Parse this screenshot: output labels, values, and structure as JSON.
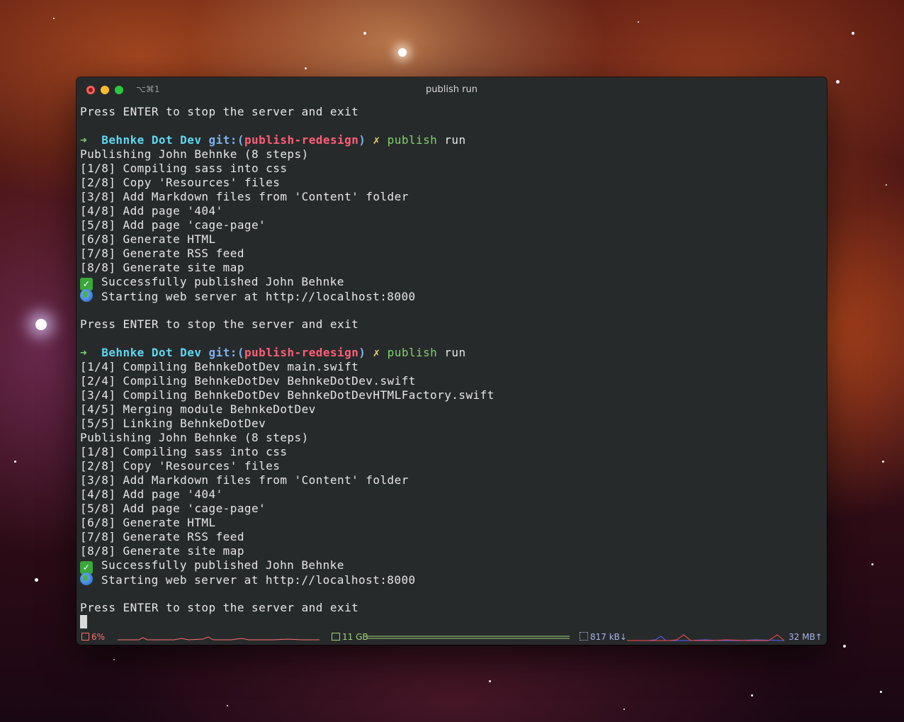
{
  "window": {
    "title": "publish run",
    "tab_shortcut": "⌥⌘1"
  },
  "terminal": {
    "lines": [
      {
        "t": "plain",
        "text": "Press ENTER to stop the server and exit"
      },
      {
        "t": "blank"
      },
      {
        "t": "prompt",
        "arrow": "➜",
        "dir": "Behnke Dot Dev",
        "git": "git:(",
        "branch": "publish-redesign",
        "git_close": ")",
        "dirty": "✗",
        "cmd": "publish",
        "args": " run"
      },
      {
        "t": "plain",
        "text": "Publishing John Behnke (8 steps)"
      },
      {
        "t": "plain",
        "text": "[1/8] Compiling sass into css"
      },
      {
        "t": "plain",
        "text": "[2/8] Copy 'Resources' files"
      },
      {
        "t": "plain",
        "text": "[3/8] Add Markdown files from 'Content' folder"
      },
      {
        "t": "plain",
        "text": "[4/8] Add page '404'"
      },
      {
        "t": "plain",
        "text": "[5/8] Add page 'cage-page'"
      },
      {
        "t": "plain",
        "text": "[6/8] Generate HTML"
      },
      {
        "t": "plain",
        "text": "[7/8] Generate RSS feed"
      },
      {
        "t": "plain",
        "text": "[8/8] Generate site map"
      },
      {
        "t": "success",
        "icon": "checkmark-icon",
        "text": "Successfully published John Behnke"
      },
      {
        "t": "server",
        "icon": "globe-icon",
        "text": "Starting web server at http://localhost:8000"
      },
      {
        "t": "blank"
      },
      {
        "t": "plain",
        "text": "Press ENTER to stop the server and exit"
      },
      {
        "t": "blank"
      },
      {
        "t": "prompt",
        "arrow": "➜",
        "dir": "Behnke Dot Dev",
        "git": "git:(",
        "branch": "publish-redesign",
        "git_close": ")",
        "dirty": "✗",
        "cmd": "publish",
        "args": " run"
      },
      {
        "t": "plain",
        "text": "[1/4] Compiling BehnkeDotDev main.swift"
      },
      {
        "t": "plain",
        "text": "[2/4] Compiling BehnkeDotDev BehnkeDotDev.swift"
      },
      {
        "t": "plain",
        "text": "[3/4] Compiling BehnkeDotDev BehnkeDotDevHTMLFactory.swift"
      },
      {
        "t": "plain",
        "text": "[4/5] Merging module BehnkeDotDev"
      },
      {
        "t": "plain",
        "text": "[5/5] Linking BehnkeDotDev"
      },
      {
        "t": "plain",
        "text": "Publishing John Behnke (8 steps)"
      },
      {
        "t": "plain",
        "text": "[1/8] Compiling sass into css"
      },
      {
        "t": "plain",
        "text": "[2/8] Copy 'Resources' files"
      },
      {
        "t": "plain",
        "text": "[3/8] Add Markdown files from 'Content' folder"
      },
      {
        "t": "plain",
        "text": "[4/8] Add page '404'"
      },
      {
        "t": "plain",
        "text": "[5/8] Add page 'cage-page'"
      },
      {
        "t": "plain",
        "text": "[6/8] Generate HTML"
      },
      {
        "t": "plain",
        "text": "[7/8] Generate RSS feed"
      },
      {
        "t": "plain",
        "text": "[8/8] Generate site map"
      },
      {
        "t": "success",
        "icon": "checkmark-icon",
        "text": "Successfully published John Behnke"
      },
      {
        "t": "server",
        "icon": "globe-icon",
        "text": "Starting web server at http://localhost:8000"
      },
      {
        "t": "blank"
      },
      {
        "t": "plain",
        "text": "Press ENTER to stop the server and exit"
      },
      {
        "t": "cursor"
      }
    ]
  },
  "statusbar": {
    "cpu": "6%",
    "memory": "11 GB",
    "net_down": "817 kB↓",
    "net_up": "32 MB↑",
    "colors": {
      "cpu": "#ff7070",
      "memory": "#9fd27a",
      "net_down": "#5a63ff",
      "net_up": "#ff4a4a"
    }
  },
  "colors": {
    "terminal_bg": "#272a2b",
    "prompt_arrow": "#7ed26b",
    "prompt_dir": "#5fd7f0",
    "prompt_git": "#7db3f0",
    "prompt_branch": "#ff5f76",
    "prompt_dirty": "#e5d46a"
  }
}
